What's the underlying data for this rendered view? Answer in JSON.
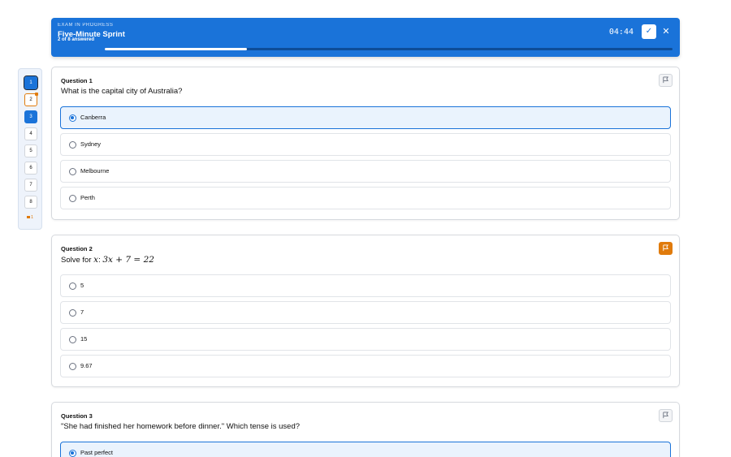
{
  "header": {
    "kicker": "EXAM IN PROGRESS",
    "title": "Five-Minute Sprint",
    "answered_text": "2 of 8 answered",
    "progress_fraction": 0.25,
    "timer": "04:44",
    "submit_icon": "check-icon",
    "close_icon": "close-icon"
  },
  "navigator": {
    "items": [
      {
        "label": "1",
        "state": "answered-current"
      },
      {
        "label": "2",
        "state": "flagged"
      },
      {
        "label": "3",
        "state": "answered"
      },
      {
        "label": "4",
        "state": "unanswered"
      },
      {
        "label": "5",
        "state": "unanswered"
      },
      {
        "label": "6",
        "state": "unanswered"
      },
      {
        "label": "7",
        "state": "unanswered"
      },
      {
        "label": "8",
        "state": "unanswered"
      }
    ],
    "flag_count": "1"
  },
  "questions": [
    {
      "number": "Question 1",
      "text": "What is the capital city of Australia?",
      "flagged": false,
      "options": [
        {
          "label": "Canberra",
          "selected": true
        },
        {
          "label": "Sydney",
          "selected": false
        },
        {
          "label": "Melbourne",
          "selected": false
        },
        {
          "label": "Perth",
          "selected": false
        }
      ]
    },
    {
      "number": "Question 2",
      "text_prefix": "Solve for ",
      "math_var": "x",
      "math_colon": ": ",
      "math_eq": "3x + 7 = 22",
      "flagged": true,
      "options": [
        {
          "label": "5",
          "selected": false
        },
        {
          "label": "7",
          "selected": false
        },
        {
          "label": "15",
          "selected": false
        },
        {
          "label": "9.67",
          "selected": false
        }
      ]
    },
    {
      "number": "Question 3",
      "text": "\"She had finished her homework before dinner.\" Which tense is used?",
      "flagged": false,
      "options": [
        {
          "label": "Past perfect",
          "selected": true
        }
      ]
    }
  ],
  "colors": {
    "primary": "#1a73d9",
    "flag": "#e07b0c"
  }
}
